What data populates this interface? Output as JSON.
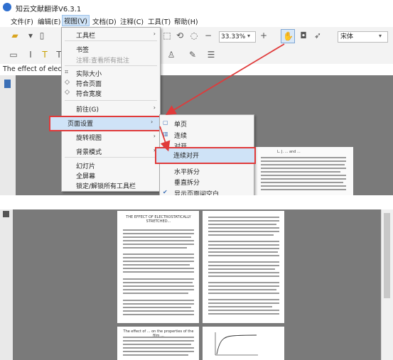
{
  "app": {
    "title": "知云文献翻译V6.3.1"
  },
  "menubar": {
    "items": [
      "文件(F)",
      "编辑(E)",
      "视图(V)",
      "文档(D)",
      "注释(C)",
      "工具(T)",
      "帮助(H)"
    ]
  },
  "toolbar": {
    "zoom": "33.33%",
    "font": "宋体"
  },
  "tab": {
    "text": "The effect of electro"
  },
  "view_menu": {
    "items": [
      {
        "label": "工具栏",
        "submenu": true,
        "disabled": false
      },
      {
        "label": "书签",
        "submenu": false,
        "disabled": false
      },
      {
        "label": "注释:查看所有批注",
        "submenu": false,
        "disabled": true
      },
      {
        "label": "实际大小",
        "submenu": false,
        "disabled": false
      },
      {
        "label": "符合页面",
        "submenu": false,
        "disabled": false
      },
      {
        "label": "符合宽度",
        "submenu": false,
        "disabled": false
      },
      {
        "label": "前往(G)",
        "submenu": true,
        "disabled": false
      },
      {
        "label": "页面设置",
        "submenu": true,
        "disabled": false
      },
      {
        "label": "旋转视图",
        "submenu": true,
        "disabled": false
      },
      {
        "label": "背景模式",
        "submenu": true,
        "disabled": false
      },
      {
        "label": "幻灯片",
        "submenu": false,
        "disabled": false
      },
      {
        "label": "全屏幕",
        "submenu": false,
        "disabled": false
      },
      {
        "label": "锁定/解锁所有工具栏",
        "submenu": false,
        "disabled": false
      }
    ]
  },
  "page_submenu": {
    "items": [
      {
        "label": "单页",
        "checked": false
      },
      {
        "label": "连续",
        "checked": false
      },
      {
        "label": "对开",
        "checked": false
      },
      {
        "label": "连续对开",
        "checked": false
      },
      {
        "label": "水平拆分",
        "checked": false
      },
      {
        "label": "垂直拆分",
        "checked": false
      },
      {
        "label": "显示页面间空白",
        "checked": true
      }
    ]
  },
  "document": {
    "page_header": "L. J. ... and ...",
    "page_title": "THE EFFECT OF ELECTROSTATICALLY STRETCHED...",
    "bottom_left_title": "The effect of ... on the properties of the film ..."
  },
  "colors": {
    "highlight": "#cfe3f7",
    "annotation": "#e03a3a",
    "accent": "#2f6fcf"
  }
}
